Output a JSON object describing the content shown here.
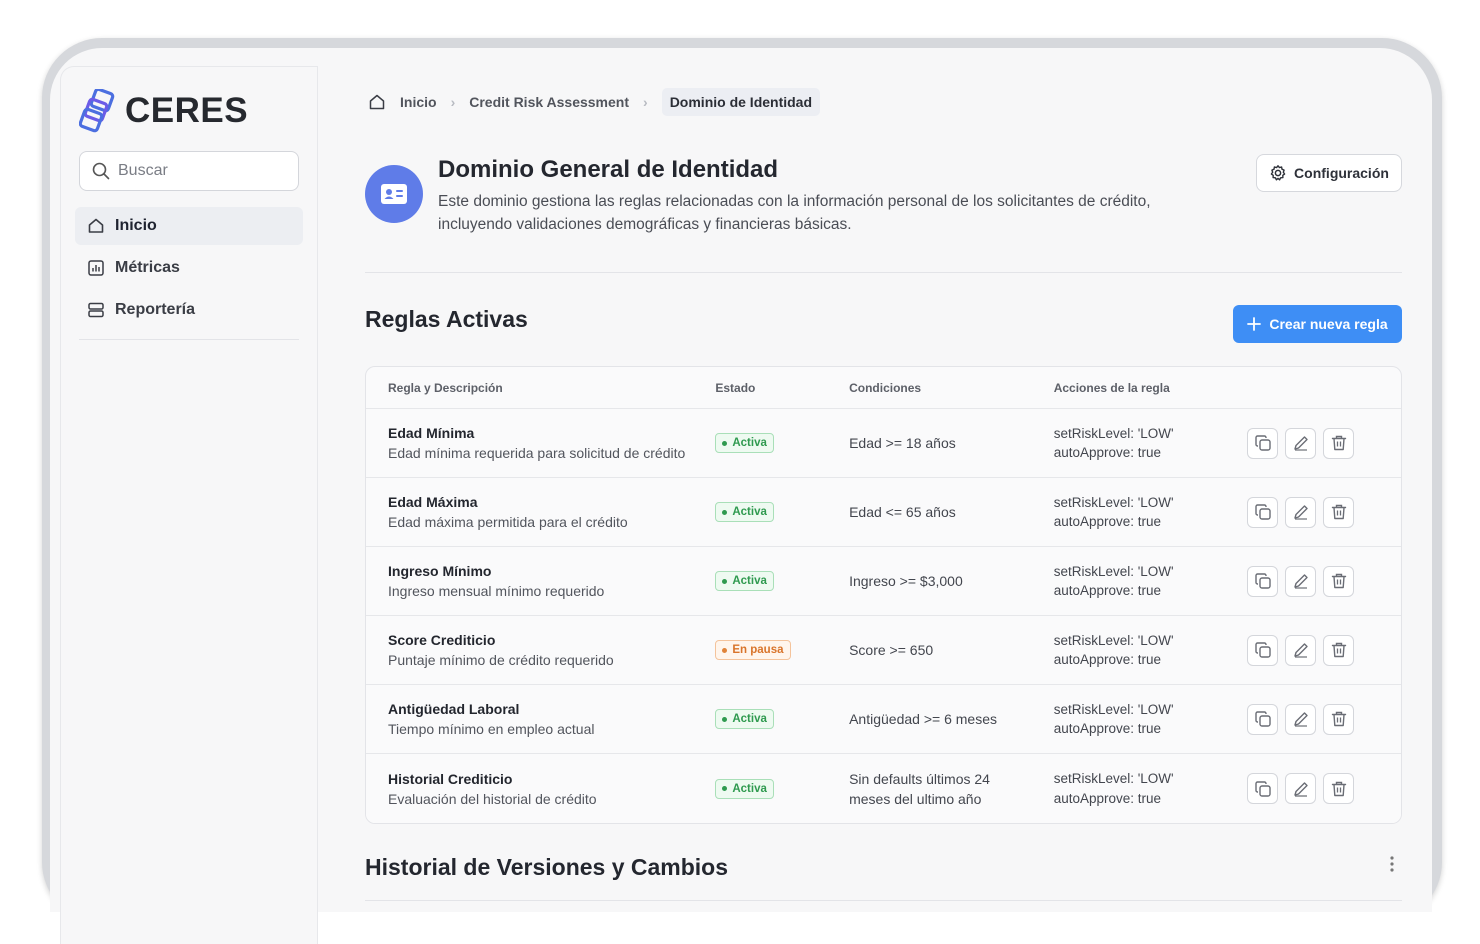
{
  "app": {
    "name": "CERES"
  },
  "sidebar": {
    "search_placeholder": "Buscar",
    "items": [
      {
        "label": "Inicio",
        "icon": "home-icon",
        "active": true
      },
      {
        "label": "Métricas",
        "icon": "chart-icon",
        "active": false
      },
      {
        "label": "Reportería",
        "icon": "server-icon",
        "active": false
      }
    ]
  },
  "breadcrumb": [
    "Inicio",
    "Credit Risk Assessment",
    "Dominio de Identidad"
  ],
  "domain": {
    "title": "Dominio General de Identidad",
    "description": "Este dominio gestiona las reglas relacionadas con la información personal de los solicitantes de crédito, incluyendo validaciones demográficas y financieras básicas.",
    "config_label": "Configuración"
  },
  "rules_section": {
    "title": "Reglas Activas",
    "create_label": "Crear nueva regla",
    "columns": [
      "Regla y Descripción",
      "Estado",
      "Condiciones",
      "Acciones de la regla"
    ],
    "rows": [
      {
        "name": "Edad Mínima",
        "desc": "Edad mínima requerida para solicitud de crédito",
        "status": "Activa",
        "cond1": "Edad >= 18 años",
        "cond2": "",
        "action1": "setRiskLevel: 'LOW'",
        "action2": "autoApprove: true"
      },
      {
        "name": "Edad Máxima",
        "desc": "Edad máxima permitida para el crédito",
        "status": "Activa",
        "cond1": "Edad <= 65 años",
        "cond2": "",
        "action1": "setRiskLevel: 'LOW'",
        "action2": "autoApprove: true"
      },
      {
        "name": "Ingreso Mínimo",
        "desc": "Ingreso mensual mínimo requerido",
        "status": "Activa",
        "cond1": "Ingreso >= $3,000",
        "cond2": "",
        "action1": "setRiskLevel: 'LOW'",
        "action2": "autoApprove: true"
      },
      {
        "name": "Score Crediticio",
        "desc": "Puntaje mínimo de crédito requerido",
        "status": "En pausa",
        "cond1": "Score >= 650",
        "cond2": "",
        "action1": "setRiskLevel: 'LOW'",
        "action2": "autoApprove: true"
      },
      {
        "name": "Antigüedad Laboral",
        "desc": "Tiempo mínimo en empleo actual",
        "status": "Activa",
        "cond1": "Antigüedad >= 6 meses",
        "cond2": "",
        "action1": "setRiskLevel: 'LOW'",
        "action2": "autoApprove: true"
      },
      {
        "name": "Historial Crediticio",
        "desc": "Evaluación del historial de crédito",
        "status": "Activa",
        "cond1": "Sin defaults últimos 24",
        "cond2": "meses del ultimo año",
        "action1": "setRiskLevel: 'LOW'",
        "action2": "autoApprove: true"
      }
    ]
  },
  "history_section": {
    "title": "Historial de Versiones y Cambios"
  },
  "colors": {
    "accent": "#3e8ef5",
    "brand": "#5f7ce8",
    "active": "#2f9a4f",
    "paused": "#d9742a"
  }
}
